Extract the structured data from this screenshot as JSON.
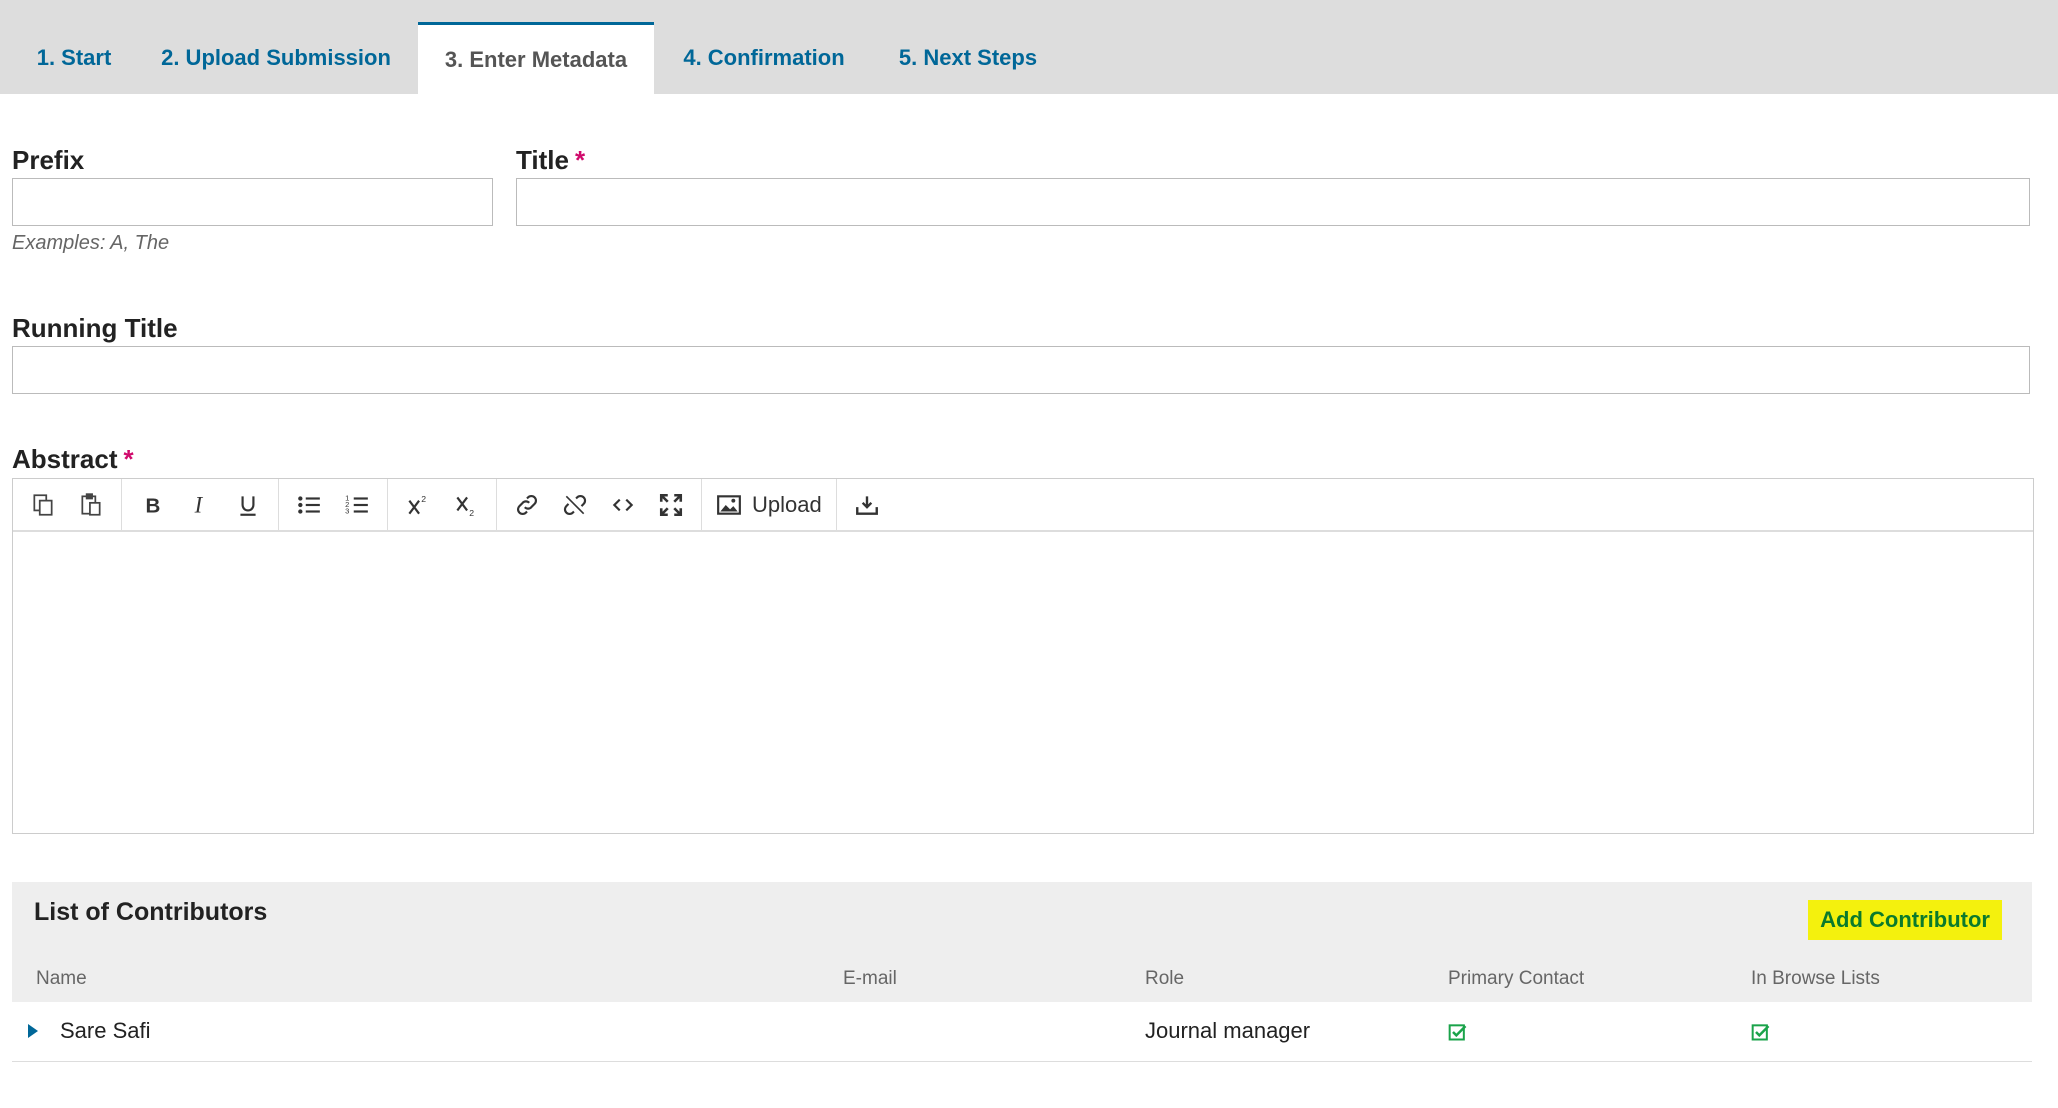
{
  "tabs": [
    {
      "label": "1. Start",
      "active": false
    },
    {
      "label": "2. Upload Submission",
      "active": false
    },
    {
      "label": "3. Enter Metadata",
      "active": true
    },
    {
      "label": "4. Confirmation",
      "active": false
    },
    {
      "label": "5. Next Steps",
      "active": false
    }
  ],
  "form": {
    "prefix_label": "Prefix",
    "prefix_value": "",
    "prefix_hint": "Examples: A, The",
    "title_label": "Title",
    "title_value": "",
    "required_mark": "*",
    "running_title_label": "Running Title",
    "running_title_value": "",
    "abstract_label": "Abstract"
  },
  "editor": {
    "toolbar_icons": [
      "copy-icon",
      "paste-icon",
      "bold-icon",
      "italic-icon",
      "underline-icon",
      "bullet-list-icon",
      "numbered-list-icon",
      "superscript-icon",
      "subscript-icon",
      "link-icon",
      "unlink-icon",
      "code-icon",
      "fullscreen-icon",
      "image-icon",
      "import-icon"
    ],
    "upload_label": "Upload"
  },
  "contributors": {
    "title": "List of Contributors",
    "add_label": "Add Contributor",
    "columns": [
      "Name",
      "E-mail",
      "Role",
      "Primary Contact",
      "In Browse Lists"
    ],
    "rows": [
      {
        "name": "Sare Safi",
        "email": "",
        "role": "Journal manager",
        "primary_contact": true,
        "in_browse_lists": true
      }
    ]
  },
  "colors": {
    "accent": "#006798",
    "required": "#d00a6c",
    "highlight": "#f4f10d",
    "check": "#1aa34a"
  }
}
